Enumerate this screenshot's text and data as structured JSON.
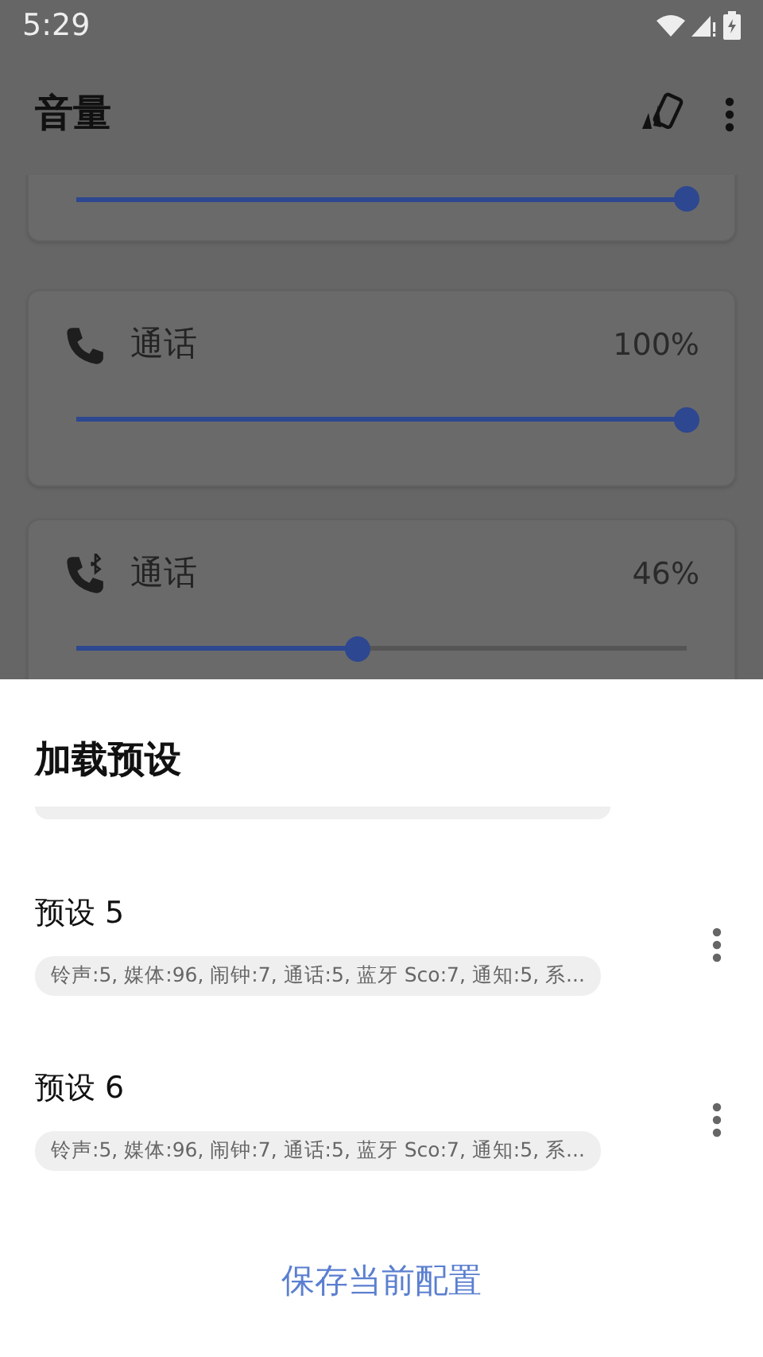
{
  "status_bar": {
    "time": "5:29"
  },
  "app_bar": {
    "title": "音量"
  },
  "volume_cards": [
    {
      "level": 1
    },
    {
      "kind": "phone",
      "name": "通话",
      "reading": "100%",
      "level": 1
    },
    {
      "kind": "bluetooth-phone",
      "name": "通话",
      "reading": "46%",
      "level": 0.46
    }
  ],
  "sheet": {
    "title": "加载预设",
    "presets": [
      {
        "name": "预设 5",
        "summary": "铃声:5, 媒体:96, 闹钟:7, 通话:5, 蓝牙 Sco:7, 通知:5, 系..."
      },
      {
        "name": "预设 6",
        "summary": "铃声:5, 媒体:96, 闹钟:7, 通话:5, 蓝牙 Sco:7, 通知:5, 系..."
      }
    ],
    "save_button": "保存当前配置"
  }
}
